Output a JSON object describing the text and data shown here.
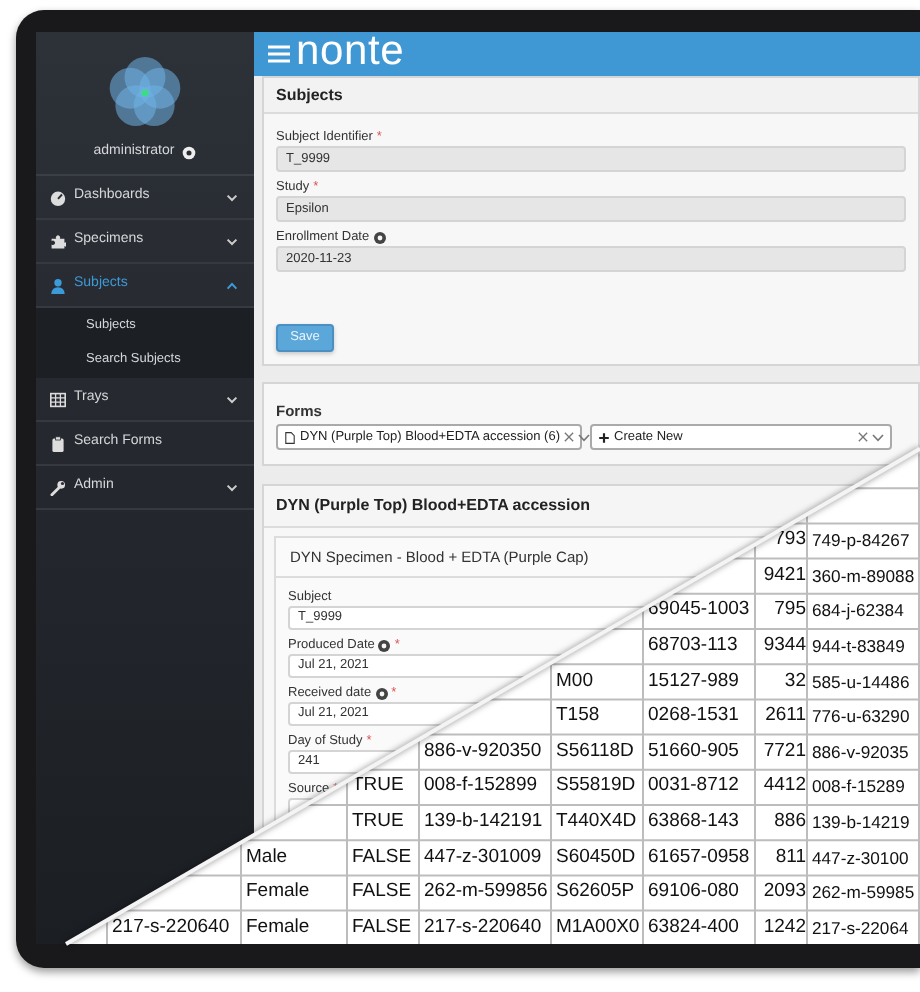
{
  "sidebar": {
    "user": "administrator",
    "items": [
      {
        "label": "Dashboards",
        "selected": false,
        "expanded": false
      },
      {
        "label": "Specimens",
        "selected": false,
        "expanded": false
      },
      {
        "label": "Subjects",
        "selected": true,
        "expanded": true,
        "children": [
          {
            "label": "Subjects"
          },
          {
            "label": "Search Subjects"
          }
        ]
      },
      {
        "label": "Trays",
        "selected": false,
        "expanded": false
      },
      {
        "label": "Search Forms",
        "selected": false
      },
      {
        "label": "Admin",
        "selected": false,
        "expanded": false
      }
    ]
  },
  "navbar": {
    "brand": "nonte"
  },
  "subject_panel": {
    "title": "Subjects",
    "fields": [
      {
        "label": "Subject Identifier",
        "required_mark": "*",
        "value": "T_9999"
      },
      {
        "label": "Study",
        "required_mark": "*",
        "value": "Epsilon"
      },
      {
        "label": "Enrollment Date",
        "help": true,
        "value": "2020-11-23"
      }
    ],
    "save": "Save"
  },
  "forms_panel": {
    "title": "Forms",
    "selects": [
      {
        "value": "DYN (Purple Top) Blood+EDTA accession (6)"
      },
      {
        "value": "Create New"
      }
    ]
  },
  "accession_panel": {
    "title": "DYN (Purple Top) Blood+EDTA accession",
    "card_title": "DYN Specimen - Blood + EDTA (Purple Cap)",
    "fields": [
      {
        "label": "Subject",
        "value": "T_9999"
      },
      {
        "label": "Produced Date",
        "help": true,
        "required_mark": "*",
        "value": "Jul 21, 2021"
      },
      {
        "label": "Received date",
        "help": true,
        "required_mark": "*",
        "value": "Jul 21, 2021"
      },
      {
        "label": "Day of Study",
        "required_mark": "*",
        "value": "241"
      },
      {
        "label": "Source",
        "required_mark": "*"
      }
    ]
  },
  "spreadsheet": {
    "rows": [
      {
        "cells": [
          "",
          "",
          "",
          "",
          "",
          "",
          "793",
          "749-p-84267"
        ]
      },
      {
        "cells": [
          "",
          "",
          "",
          "",
          "",
          "",
          "9421",
          "360-m-89088"
        ]
      },
      {
        "cells": [
          "",
          "",
          "",
          "",
          "",
          "69045-1003",
          "795",
          "684-j-62384"
        ]
      },
      {
        "cells": [
          "",
          "",
          "",
          "",
          "",
          "68703-113",
          "9344",
          "944-t-83849"
        ]
      },
      {
        "cells": [
          "",
          "",
          "",
          "",
          "M00",
          "15127-989",
          "32",
          "585-u-14486"
        ]
      },
      {
        "cells": [
          "",
          "",
          "",
          "",
          "T158",
          "0268-1531",
          "2611",
          "776-u-63290"
        ]
      },
      {
        "cells": [
          "",
          "",
          "",
          "886-v-920350",
          "S56118D",
          "51660-905",
          "7721",
          "886-v-92035"
        ]
      },
      {
        "cells": [
          "",
          "",
          "TRUE",
          "008-f-152899",
          "S55819D",
          "0031-8712",
          "4412",
          "008-f-15289"
        ]
      },
      {
        "cells": [
          "",
          "",
          "TRUE",
          "139-b-142191",
          "T440X4D",
          "63868-143",
          "886",
          "139-b-14219"
        ]
      },
      {
        "cells": [
          "",
          "Male",
          "FALSE",
          "447-z-301009",
          "S60450D",
          "61657-0958",
          "811",
          "447-z-30100"
        ]
      },
      {
        "cells": [
          "",
          "Female",
          "FALSE",
          "262-m-599856",
          "S62605P",
          "69106-080",
          "2093",
          "262-m-59985"
        ]
      },
      {
        "cells": [
          "217-s-220640",
          "Female",
          "FALSE",
          "217-s-220640",
          "M1A00X0",
          "63824-400",
          "1242",
          "217-s-22064"
        ]
      }
    ]
  }
}
